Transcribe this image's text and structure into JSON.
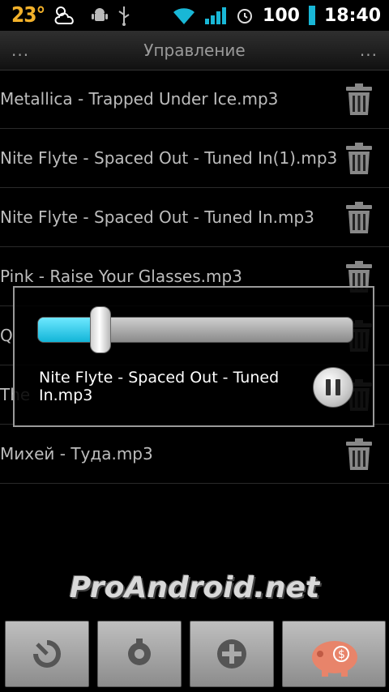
{
  "status": {
    "temperature": "23°",
    "battery": "100",
    "time": "18:40"
  },
  "header": {
    "left_dots": "...",
    "title": "Управление",
    "right_dots": "..."
  },
  "tracks": [
    "Metallica - Trapped Under Ice.mp3",
    "Nite Flyte - Spaced Out - Tuned In(1).mp3",
    "Nite Flyte - Spaced Out - Tuned In.mp3",
    "Pink - Raise Your Glasses.mp3",
    "Q",
    "The",
    "Михей - Туда.mp3"
  ],
  "player": {
    "now_playing": "Nite Flyte - Spaced Out - Tuned In.mp3",
    "progress": 0.2
  },
  "watermark": "ProAndroid.net",
  "colors": {
    "accent": "#18c3e6",
    "temp": "#f2b12a",
    "wifi": "#19b7d6"
  },
  "icons": {
    "status": [
      "weather-icon",
      "android-icon",
      "usb-icon",
      "wifi-icon",
      "signal-icon",
      "alarm-icon",
      "battery-icon"
    ],
    "bottom": [
      "history-icon",
      "settings-icon",
      "add-icon",
      "piggy-bank-icon"
    ]
  }
}
